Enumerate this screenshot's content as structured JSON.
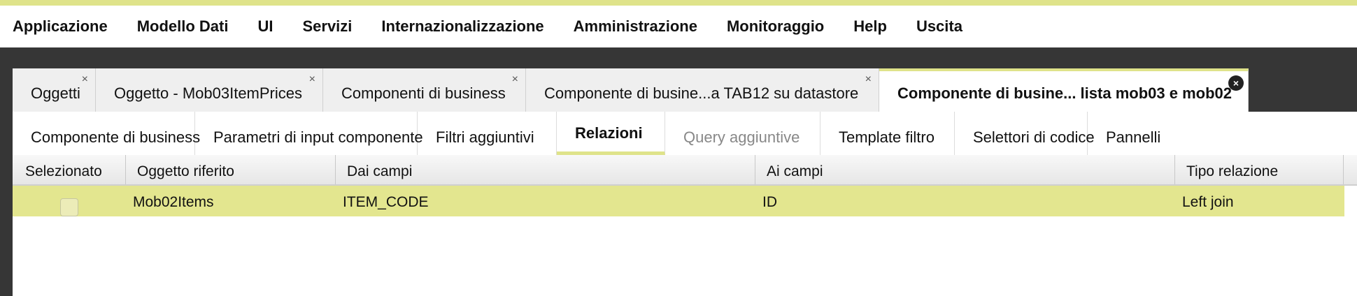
{
  "menu": {
    "items": [
      "Applicazione",
      "Modello Dati",
      "UI",
      "Servizi",
      "Internazionalizzazione",
      "Amministrazione",
      "Monitoraggio",
      "Help",
      "Uscita"
    ]
  },
  "document_tabs": [
    {
      "label": "Oggetti",
      "close": "×"
    },
    {
      "label": "Oggetto - Mob03ItemPrices",
      "close": "×"
    },
    {
      "label": "Componenti di business",
      "close": "×"
    },
    {
      "label": "Componente di busine...a TAB12 su datastore",
      "close": "×"
    },
    {
      "label": "Componente di busine... lista mob03 e mob02",
      "close": "×",
      "active": true
    }
  ],
  "sub_tabs": [
    {
      "label": "Componente di business"
    },
    {
      "label": "Parametri di input componente"
    },
    {
      "label": "Filtri aggiuntivi"
    },
    {
      "label": "Relazioni",
      "active": true
    },
    {
      "label": "Query aggiuntive",
      "disabled": true
    },
    {
      "label": "Template filtro"
    },
    {
      "label": "Selettori di codice"
    },
    {
      "label": "Pannelli"
    }
  ],
  "grid": {
    "columns": [
      "Selezionato",
      "Oggetto riferito",
      "Dai campi",
      "Ai campi",
      "Tipo relazione"
    ],
    "rows": [
      {
        "selected": false,
        "oggetto_riferito": "Mob02Items",
        "dai_campi": "ITEM_CODE",
        "ai_campi": "ID",
        "tipo_relazione": "Left join"
      }
    ]
  },
  "colors": {
    "accent": "#dfe38a",
    "selected_row": "#e3e68f",
    "dark_band": "#363636"
  },
  "icons": {
    "tab_close": "close-icon",
    "active_tab_close": "close-circle-icon"
  }
}
